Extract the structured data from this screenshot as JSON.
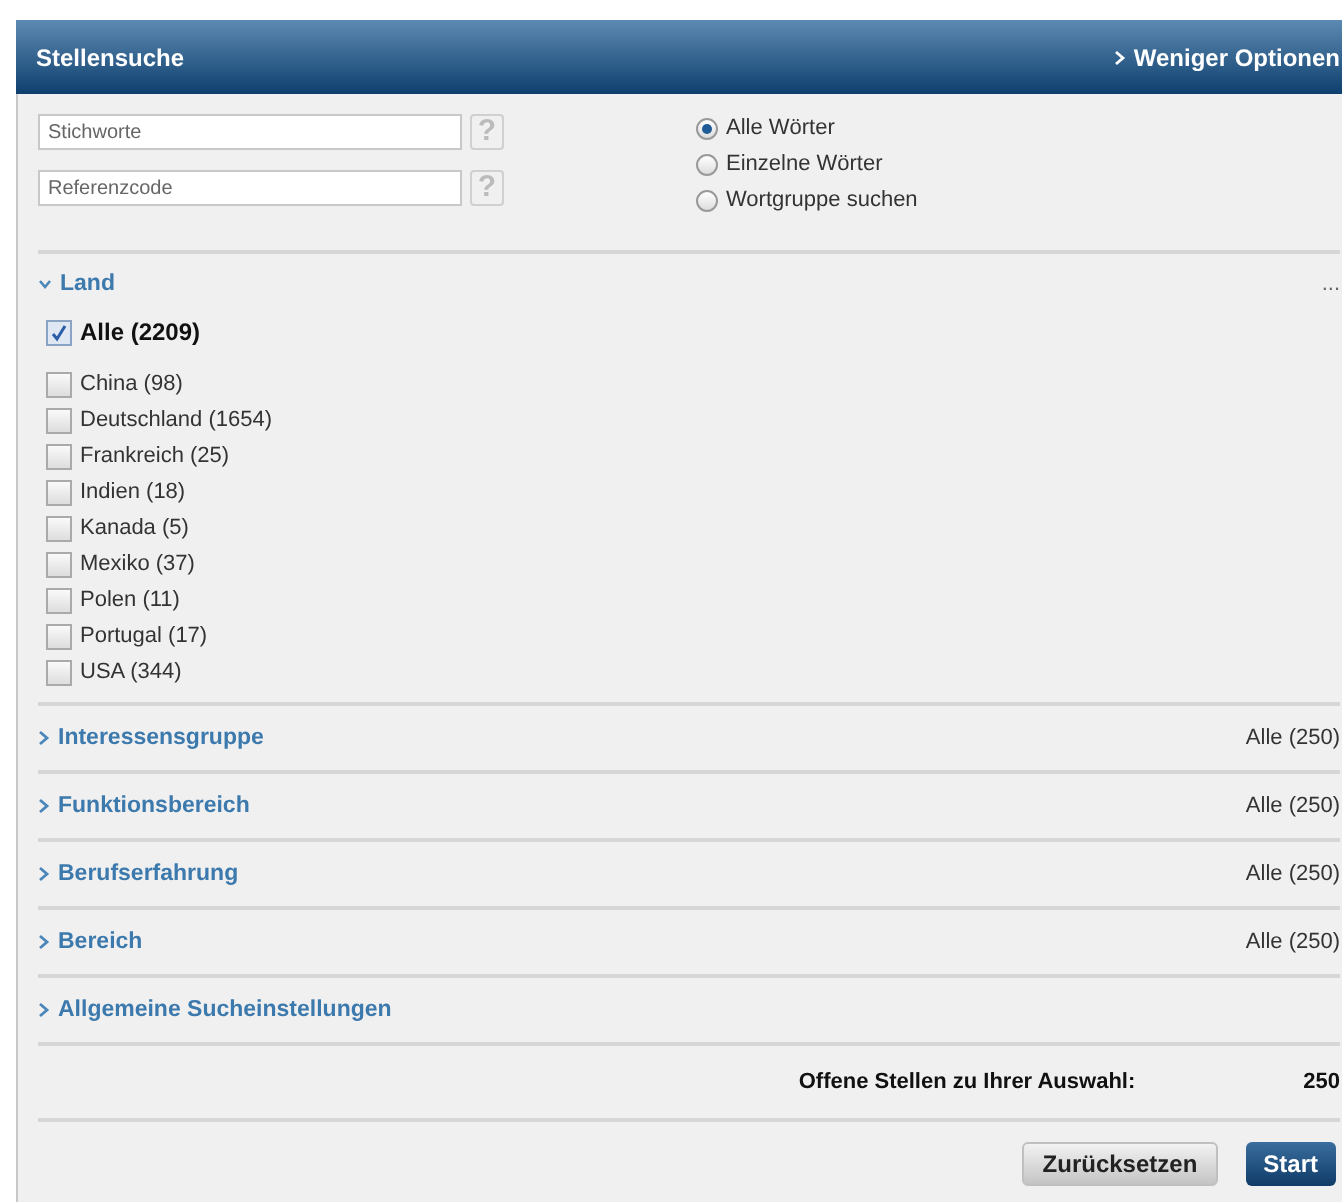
{
  "header": {
    "title": "Stellensuche",
    "toggle": "Weniger Optionen"
  },
  "fields": [
    {
      "placeholder": "Stichworte",
      "help": "?"
    },
    {
      "placeholder": "Referenzcode",
      "help": "?"
    }
  ],
  "match_options": [
    {
      "label": "Alle Wörter",
      "selected": true
    },
    {
      "label": "Einzelne Wörter",
      "selected": false
    },
    {
      "label": "Wortgruppe suchen",
      "selected": false
    }
  ],
  "sections": [
    {
      "title": "Land",
      "expanded": true,
      "more": "...",
      "all": {
        "label": "Alle (2209)",
        "checked": true
      },
      "options": [
        {
          "label": "China (98)",
          "checked": false
        },
        {
          "label": "Deutschland (1654)",
          "checked": false
        },
        {
          "label": "Frankreich (25)",
          "checked": false
        },
        {
          "label": "Indien (18)",
          "checked": false
        },
        {
          "label": "Kanada (5)",
          "checked": false
        },
        {
          "label": "Mexiko (37)",
          "checked": false
        },
        {
          "label": "Polen (11)",
          "checked": false
        },
        {
          "label": "Portugal (17)",
          "checked": false
        },
        {
          "label": "USA (344)",
          "checked": false
        }
      ]
    },
    {
      "title": "Interessensgruppe",
      "expanded": false,
      "summary": "Alle (250)"
    },
    {
      "title": "Funktionsbereich",
      "expanded": false,
      "summary": "Alle (250)"
    },
    {
      "title": "Berufserfahrung",
      "expanded": false,
      "summary": "Alle (250)"
    },
    {
      "title": "Bereich",
      "expanded": false,
      "summary": "Alle (250)"
    },
    {
      "title": "Allgemeine Sucheinstellungen",
      "expanded": false
    }
  ],
  "result": {
    "label": "Offene Stellen zu Ihrer Auswahl:",
    "count": "250"
  },
  "buttons": [
    {
      "label": "Zurücksetzen",
      "kind": "secondary"
    },
    {
      "label": "Start",
      "kind": "primary"
    }
  ]
}
